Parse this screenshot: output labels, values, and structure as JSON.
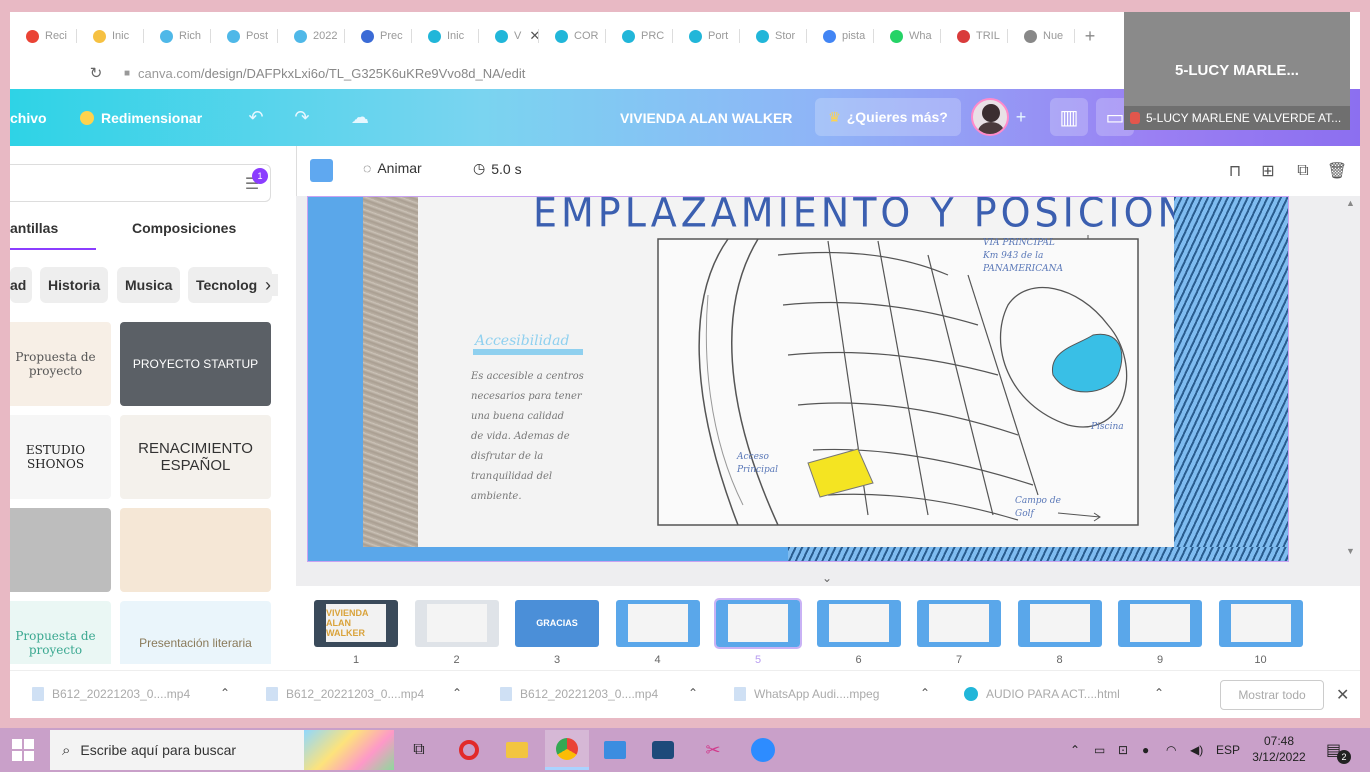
{
  "browser": {
    "tabs": [
      {
        "label": "Reci",
        "icon": "gmail-icon",
        "color": "#ea4335"
      },
      {
        "label": "Inic",
        "icon": "notes-icon",
        "color": "#f6c142"
      },
      {
        "label": "Rich",
        "icon": "canva-icon",
        "color": "#4fb8e8"
      },
      {
        "label": "Post",
        "icon": "canva-icon",
        "color": "#4fb8e8"
      },
      {
        "label": "2022",
        "icon": "canva-icon",
        "color": "#4fb8e8"
      },
      {
        "label": "Prec",
        "icon": "board-icon",
        "color": "#3b6bd6"
      },
      {
        "label": "Inic",
        "icon": "canva-icon",
        "color": "#21b6d9"
      },
      {
        "label": "V",
        "icon": "canva-icon",
        "color": "#21b6d9",
        "active": true
      },
      {
        "label": "COR",
        "icon": "canva-icon",
        "color": "#21b6d9"
      },
      {
        "label": "PRC",
        "icon": "canva-icon",
        "color": "#21b6d9"
      },
      {
        "label": "Port",
        "icon": "canva-icon",
        "color": "#21b6d9"
      },
      {
        "label": "Stor",
        "icon": "canva-icon",
        "color": "#21b6d9"
      },
      {
        "label": "pista",
        "icon": "google-icon",
        "color": "#4285f4"
      },
      {
        "label": "Wha",
        "icon": "whatsapp-icon",
        "color": "#25d366"
      },
      {
        "label": "TRIL",
        "icon": "shield-icon",
        "color": "#d93b3b"
      },
      {
        "label": "Nue",
        "icon": "chrome-icon",
        "color": "#888888"
      }
    ],
    "url_host": "canva.com",
    "url_path": "/design/DAFPkxLxi6o/TL_G325K6uKRe9Vvo8d_NA/edit"
  },
  "zoom": {
    "name_big": "5-LUCY MARLE...",
    "name_bar": "5-LUCY MARLENE VALVERDE AT..."
  },
  "canva_top": {
    "file_menu": "chivo",
    "resize": "Redimensionar",
    "design_title": "VIVIENDA ALAN WALKER",
    "premium_cta": "¿Quieres más?"
  },
  "left_panel": {
    "tabs": [
      "antillas",
      "Composiciones"
    ],
    "chips": [
      "ad",
      "Historia",
      "Musica",
      "Tecnologia"
    ],
    "filter_badge": "1",
    "templates": [
      {
        "text": "Propuesta de proyecto",
        "bg": "#f7efe6",
        "fg": "#555555"
      },
      {
        "text": "PROYECTO STARTUP",
        "bg": "#5b6066",
        "fg": "#ffffff"
      },
      {
        "text": "ESTUDIO SHONOS",
        "bg": "#f6f6f6",
        "fg": "#222222"
      },
      {
        "text": "RENACIMIENTO ESPAÑOL",
        "bg": "#f4f1ec",
        "fg": "#333333"
      },
      {
        "text": "",
        "bg": "#bdbdbd",
        "fg": "#222222"
      },
      {
        "text": "",
        "bg": "#f5e7d6",
        "fg": "#aaaaaa"
      },
      {
        "text": "Propuesta de proyecto",
        "bg": "#eaf7f4",
        "fg": "#3aa890"
      },
      {
        "text": "Presentación literaria",
        "bg": "#eaf5fb",
        "fg": "#8a7a5a"
      }
    ]
  },
  "editor": {
    "animate": "Animar",
    "duration": "5.0 s",
    "slide": {
      "title": "EMPLAZAMIENTO Y POSICIONAMIENTO",
      "left_heading": "Accesibilidad",
      "left_text": "Es accesible a centros\nnecesarios para tener\nuna buena calidad\nde vida. Ademas de\ndisfrutar de la\ntranquilidad del\nambiente.",
      "map_via": "VIA PRINCIPAL\nKm 943 de la\nPANAMERICANA",
      "map_acceso": "Acceso\nPrincipal",
      "map_piscina": "Piscina",
      "map_golf": "Campo de\nGolf"
    }
  },
  "pages": {
    "items": [
      {
        "num": "1",
        "label": "VIVIENDA ALAN WALKER",
        "bg": "#3a4a5a"
      },
      {
        "num": "2",
        "label": "",
        "bg": "#dfe3e8"
      },
      {
        "num": "3",
        "label": "GRACIAS",
        "bg": "#4b8fd8"
      },
      {
        "num": "4",
        "label": "",
        "bg": "#5aa7ea"
      },
      {
        "num": "5",
        "label": "",
        "bg": "#5aa7ea",
        "selected": true
      },
      {
        "num": "6",
        "label": "",
        "bg": "#5aa7ea"
      },
      {
        "num": "7",
        "label": "",
        "bg": "#5aa7ea"
      },
      {
        "num": "8",
        "label": "",
        "bg": "#5aa7ea"
      },
      {
        "num": "9",
        "label": "",
        "bg": "#5aa7ea"
      },
      {
        "num": "10",
        "label": "",
        "bg": "#5aa7ea"
      }
    ]
  },
  "downloads": {
    "items": [
      "B612_20221203_0....mp4",
      "B612_20221203_0....mp4",
      "B612_20221203_0....mp4",
      "WhatsApp Audi....mpeg",
      "AUDIO PARA ACT....html"
    ],
    "show_all": "Mostrar todo"
  },
  "taskbar": {
    "search_placeholder": "Escribe aquí para buscar",
    "lang": "ESP",
    "time": "07:48",
    "date": "3/12/2022",
    "notifications": "2"
  },
  "colors": {
    "canva_purple": "#8b3dff",
    "slide_blue": "#5aa7ea",
    "taskbar": "#c9a0c9"
  }
}
